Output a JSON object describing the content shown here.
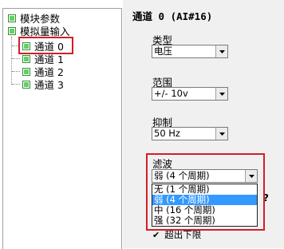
{
  "tree": {
    "items": [
      {
        "label": "模块参数"
      },
      {
        "label": "模拟量输入"
      },
      {
        "label": "通道 0"
      },
      {
        "label": "通道 1"
      },
      {
        "label": "通道 2"
      },
      {
        "label": "通道 3"
      }
    ]
  },
  "channel": {
    "title": "通道 0 (AI#16)",
    "type": {
      "label": "类型",
      "value": "电压"
    },
    "range": {
      "label": "范围",
      "value": "+/- 10v"
    },
    "suppression": {
      "label": "抑制",
      "value": "50 Hz"
    },
    "filter": {
      "label": "滤波",
      "value": "弱 (4 个周期)",
      "options": [
        "无 (1 个周期)",
        "弱 (4 个周期)",
        "中 (16 个周期)",
        "强 (32 个周期)"
      ],
      "selected_index": 1
    }
  },
  "behind": {
    "question_mark": "?",
    "checkbox_label": "超出下限"
  },
  "colors": {
    "highlight": "#d21e2a",
    "selection": "#3399ff",
    "node_fill": "#5fd35f"
  }
}
